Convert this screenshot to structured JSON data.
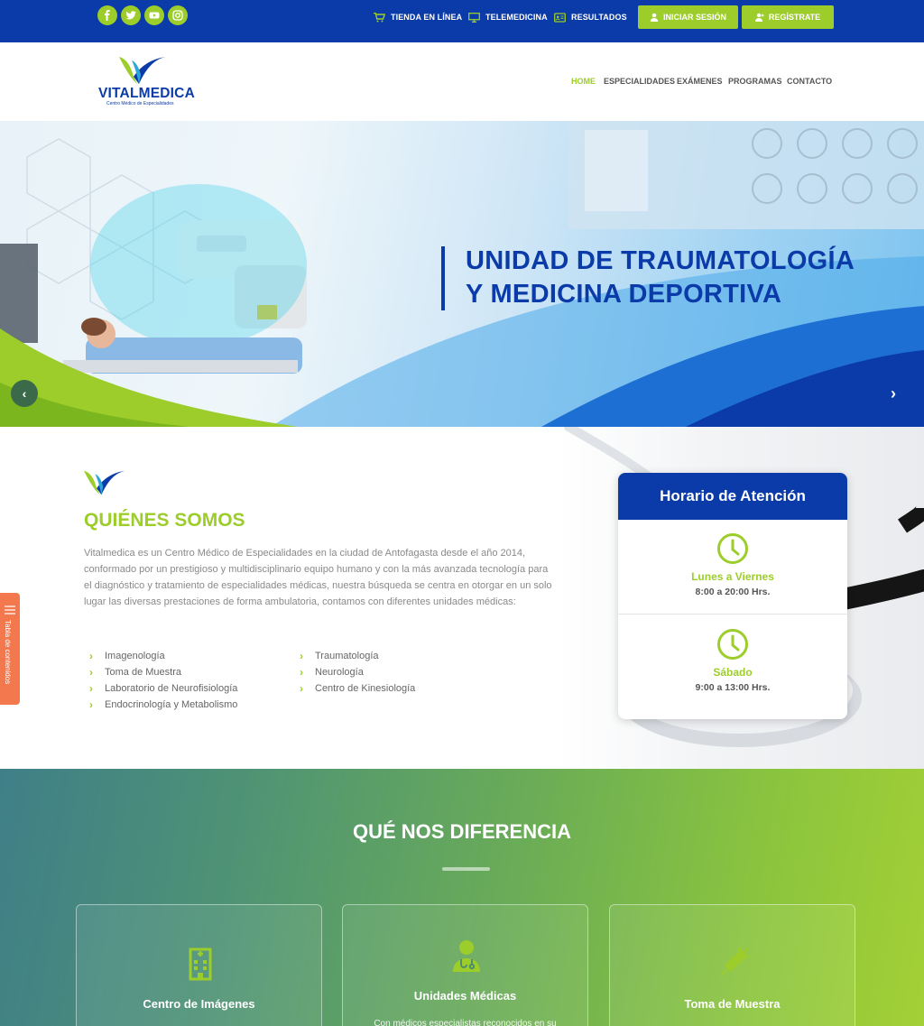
{
  "topbar": {
    "social": [
      "facebook-icon",
      "twitter-icon",
      "youtube-icon",
      "instagram-icon"
    ],
    "links": {
      "store": "TIENDA EN LÍNEA",
      "telemedicine": "TELEMEDICINA",
      "results": "RESULTADOS"
    },
    "buttons": {
      "login": "INICIAR SESIÓN",
      "register": "REGÍSTRATE"
    }
  },
  "header": {
    "logo_text": "VITALMEDICA",
    "logo_sub": "Centro Médico de Especialidades",
    "nav": [
      "HOME",
      "ESPECIALIDADES",
      "EXÁMENES",
      "PROGRAMAS",
      "CONTACTO"
    ],
    "active_nav": "HOME"
  },
  "hero": {
    "line1": "UNIDAD DE TRAUMATOLOGÍA",
    "line2": "Y MEDICINA DEPORTIVA",
    "prev": "‹",
    "next": "›"
  },
  "about": {
    "title": "QUIÉNES SOMOS",
    "text": "Vitalmedica es un Centro Médico de Especialidades en la ciudad de Antofagasta desde el año 2014, conformado por un prestigioso y multidisciplinario equipo humano y con la más avanzada tecnología para el diagnóstico y tratamiento de especialidades médicas, nuestra búsqueda se centra en otorgar en un solo lugar las diversas prestaciones de forma ambulatoria, contamos con diferentes unidades médicas:",
    "units_left": [
      "Imagenología",
      "Toma de Muestra",
      "Laboratorio de Neurofisiología",
      "Endocrinología y Metabolismo"
    ],
    "units_right": [
      "Traumatología",
      "Neurología",
      "Centro de Kinesiología"
    ]
  },
  "hours": {
    "title": "Horario de Atención",
    "weekday_label": "Lunes a Viernes",
    "weekday_time": "8:00 a 20:00 Hrs.",
    "saturday_label": "Sábado",
    "saturday_time": "9:00 a 13:00 Hrs."
  },
  "sidetab": {
    "label": "Tabla de contenidos"
  },
  "difference": {
    "title": "QUÉ NOS DIFERENCIA",
    "cards": [
      {
        "label": "Centro de Imágenes",
        "icon": "building-icon"
      },
      {
        "label": "Unidades Médicas",
        "icon": "doctor-icon",
        "text": "Con médicos especialistas reconocidos en su"
      },
      {
        "label": "Toma de Muestra",
        "icon": "syringe-icon"
      }
    ]
  },
  "colors": {
    "brand_blue": "#0a3ba8",
    "brand_green": "#9ccd2a",
    "sidetab_orange": "#f4784d"
  }
}
